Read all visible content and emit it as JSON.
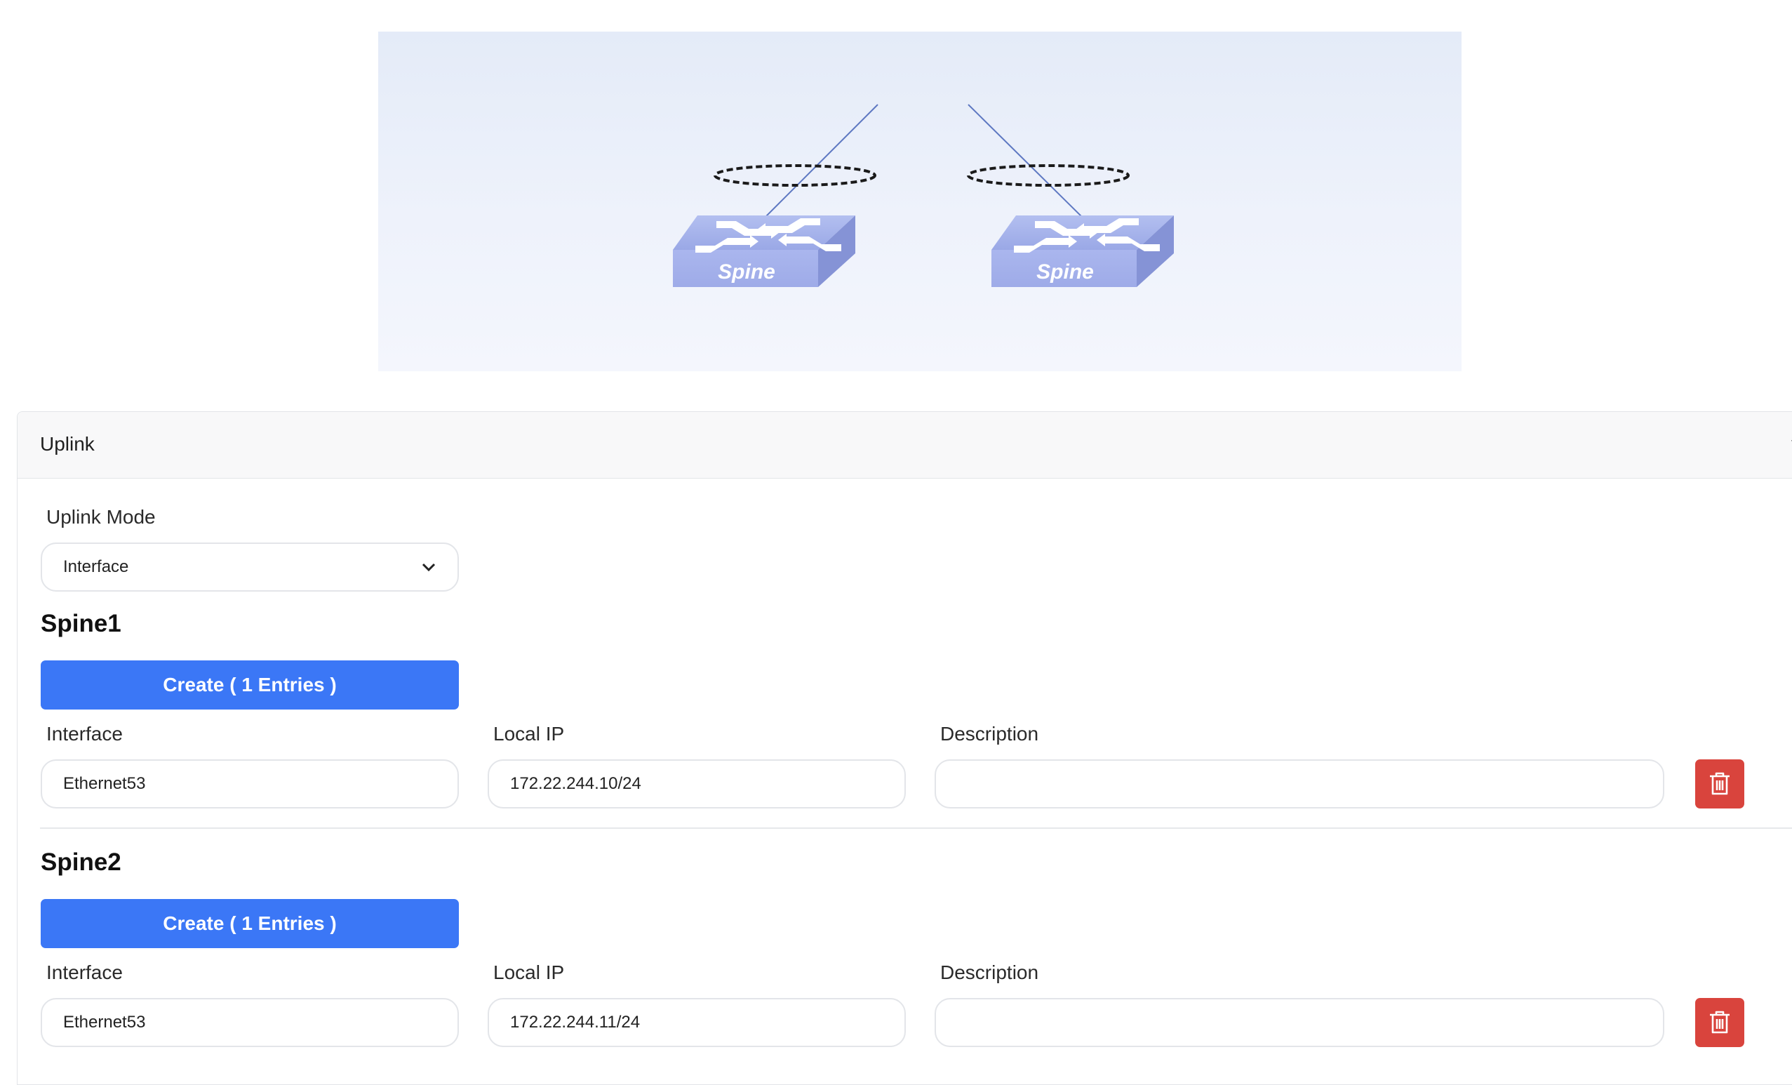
{
  "diagram": {
    "switch_labels": [
      "Spine",
      "Spine"
    ]
  },
  "uplink": {
    "title": "Uplink",
    "mode_label": "Uplink Mode",
    "mode_value": "Interface"
  },
  "spines": [
    {
      "title": "Spine1",
      "create_label": "Create ( 1 Entries )",
      "interface_label": "Interface",
      "local_ip_label": "Local IP",
      "description_label": "Description",
      "interface_value": "Ethernet53",
      "local_ip_value": "172.22.244.10/24",
      "description_value": ""
    },
    {
      "title": "Spine2",
      "create_label": "Create ( 1 Entries )",
      "interface_label": "Interface",
      "local_ip_label": "Local IP",
      "description_label": "Description",
      "interface_value": "Ethernet53",
      "local_ip_value": "172.22.244.11/24",
      "description_value": ""
    }
  ],
  "colors": {
    "primary": "#3b77f6",
    "danger": "#d9443d",
    "switch": "#a6b3ea"
  },
  "icons": [
    "chevron-down-icon",
    "trash-icon",
    "switch-icon"
  ]
}
